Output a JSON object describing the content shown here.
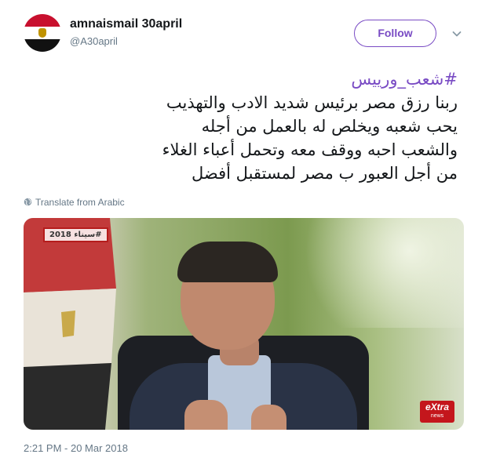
{
  "user": {
    "display_name": "amnaismail 30april",
    "handle": "@A30april",
    "avatar_icon": "egypt-flag-avatar"
  },
  "actions": {
    "follow_label": "Follow",
    "menu_icon": "chevron-down-icon"
  },
  "tweet": {
    "hashtag": "#شعب_ورييس",
    "lines": [
      "ربنا رزق مصر برئيس شديد الادب والتهذيب",
      "يحب شعبه ويخلص له بالعمل من أجله",
      "والشعب احبه ووقف معه وتحمل أعباء الغلاء",
      "من أجل العبور ب مصر لمستقبل أفضل"
    ]
  },
  "translate": {
    "label": "Translate from Arabic",
    "icon": "globe-icon"
  },
  "media": {
    "tag": "#سيناء 2018",
    "channel_logo_main": "eXtra",
    "channel_logo_sub": "news"
  },
  "timestamp": "2:21 PM - 20 Mar 2018",
  "colors": {
    "accent": "#794bc4",
    "secondary_text": "#657786",
    "primary_text": "#14171a"
  }
}
